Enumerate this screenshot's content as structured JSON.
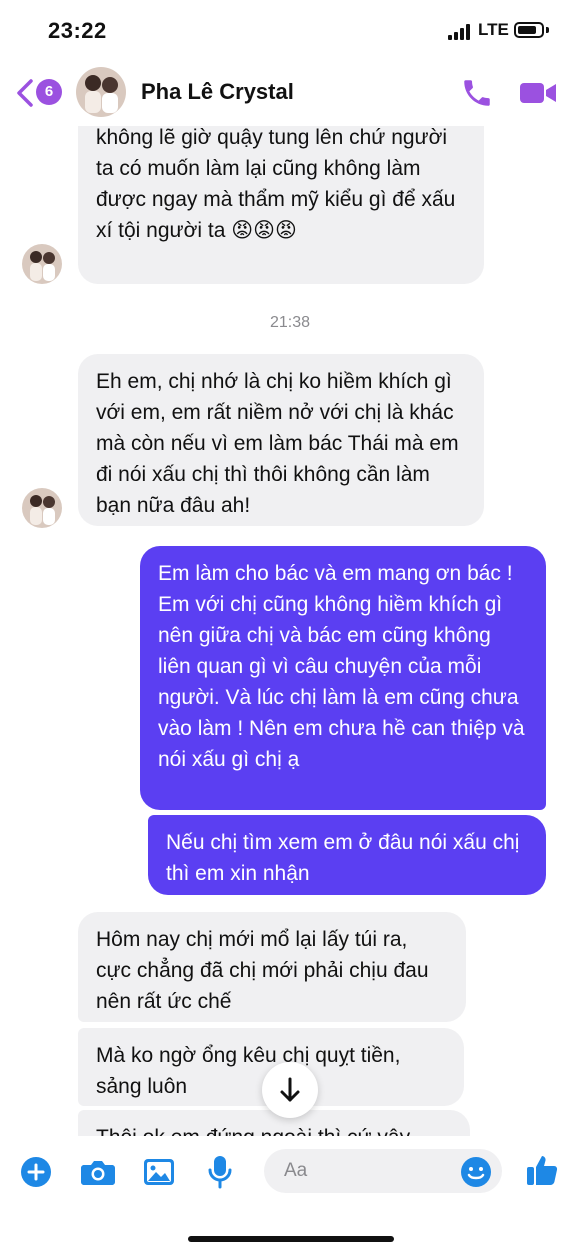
{
  "status_bar": {
    "time": "23:22",
    "network": "LTE"
  },
  "header": {
    "back_badge_count": "6",
    "contact_name": "Pha Lê Crystal"
  },
  "colors": {
    "accent": "#9b51e0",
    "outgoing_bubble": "#5b3ff2",
    "incoming_bubble": "#f0f0f2",
    "messenger_blue": "#1e88e5"
  },
  "messages": [
    {
      "side": "in",
      "text": "không lẽ giờ quậy tung lên chứ người ta có muốn làm lại cũng không làm được ngay mà thẩm mỹ kiểu gì để xấu xí tội người ta 😡😡😡"
    },
    {
      "side": "in",
      "text": "Eh em, chị nhớ là chị ko hiềm khích gì với em, em rất niềm nở với chị là khác mà còn nếu vì em làm bác Thái mà em đi nói xấu chị thì thôi không cần làm bạn nữa đâu ah!"
    },
    {
      "side": "out",
      "text": "Em làm cho bác và em mang ơn bác ! Em với chị cũng không hiềm khích gì nên giữa chị và bác em cũng không liên quan gì vì câu chuyện của mỗi người. Và lúc chị làm là em cũng chưa vào làm ! Nên em chưa hề can thiệp và nói xấu gì chị ạ"
    },
    {
      "side": "out",
      "text": "Nếu chị tìm xem em ở đâu nói xấu chị thì em xin nhận"
    },
    {
      "side": "in",
      "text": "Hôm nay chị mới mổ lại lấy túi ra, cực chẳng đã chị mới phải chịu đau nên rất ức chế"
    },
    {
      "side": "in",
      "text": "Mà ko ngờ ổng kêu chị quỵt tiền, sảng luôn"
    },
    {
      "side": "in",
      "text": "Thôi ok em đứng ngoài thì cứ vậy"
    }
  ],
  "timestamp": "21:38",
  "composer": {
    "placeholder": "Aa",
    "icons": [
      "plus-icon",
      "camera-icon",
      "image-icon",
      "microphone-icon",
      "emoji-icon",
      "like-icon"
    ]
  }
}
